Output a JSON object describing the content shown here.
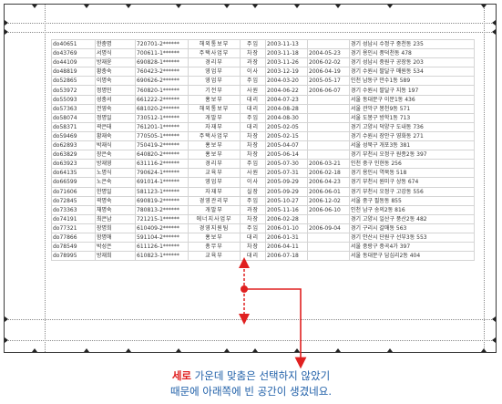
{
  "sheet": {
    "rows": [
      [
        "do40651",
        "한충명",
        "720701-2******",
        "해외통보부",
        "주임",
        "2003-11-13",
        "",
        "경기 성남시 수정구 중천동 235"
      ],
      [
        "do43769",
        "서명식",
        "700611-1******",
        "주택사업부",
        "차장",
        "2003-11-18",
        "2004-05-23",
        "경기 용인시 풍덕천동 478"
      ],
      [
        "do44109",
        "방재윤",
        "690828-1******",
        "경리부",
        "과장",
        "2003-11-26",
        "2006-02-02",
        "경기 성남시 중원구 공장동 203"
      ],
      [
        "do48819",
        "황충숙",
        "760423-2******",
        "영업부",
        "이사",
        "2003-12-19",
        "2006-04-19",
        "경기 수원시 팔달구 매원동 534"
      ],
      [
        "do52865",
        "이명숙",
        "690626-2******",
        "영업부",
        "주임",
        "2004-03-20",
        "2005-05-17",
        "인천 남동구 만수1동 589"
      ],
      [
        "do53972",
        "정명민",
        "760820-1******",
        "기전부",
        "사원",
        "2004-06-22",
        "2006-06-07",
        "경기 수원시 팔달구 지동 197"
      ],
      [
        "do55093",
        "성충서",
        "661222-2******",
        "홍보부",
        "대리",
        "2004-07-23",
        "",
        "서울 동대문구 이문1동 436"
      ],
      [
        "do57363",
        "전영숙",
        "681020-2******",
        "해외통보부",
        "대리",
        "2004-08-28",
        "",
        "서울 관악구 봉천9동 571"
      ],
      [
        "do58074",
        "정명일",
        "730512-1******",
        "개발부",
        "주임",
        "2004-08-30",
        "",
        "서울 도봉구 방학1동 713"
      ],
      [
        "do58371",
        "곽은태",
        "761201-1******",
        "자재부",
        "대리",
        "2005-02-05",
        "",
        "경기 고양시 덕양구 도내동 736"
      ],
      [
        "do59469",
        "황재숙",
        "770505-1******",
        "주택사업부",
        "차장",
        "2005-02-15",
        "",
        "경기 수원시 장안구 영화동 271"
      ],
      [
        "do62893",
        "박재식",
        "750419-2******",
        "홍보부",
        "차장",
        "2005-04-07",
        "",
        "서울 성북구 개포3동 381"
      ],
      [
        "do63829",
        "장은숙",
        "640820-2******",
        "홍보부",
        "차장",
        "2005-06-14",
        "",
        "경기 부천시 오정구 원종2동 397"
      ],
      [
        "do63923",
        "방재영",
        "631116-2******",
        "경리부",
        "주임",
        "2005-07-30",
        "2006-03-21",
        "인천 중구 인현동 256"
      ],
      [
        "do64135",
        "노명식",
        "790624-1******",
        "교육부",
        "사원",
        "2005-07-31",
        "2006-02-18",
        "경기 용인시 역북동 518"
      ],
      [
        "do66599",
        "노은숙",
        "691014-1******",
        "영업부",
        "이사",
        "2005-09-29",
        "2006-04-23",
        "경기 부천시 원미구 상동 674"
      ],
      [
        "do71606",
        "한명일",
        "581123-1******",
        "자재부",
        "실장",
        "2005-09-29",
        "2006-06-01",
        "경기 부천시 오정구 고강동 556"
      ],
      [
        "do72845",
        "곽명숙",
        "690819-2******",
        "경영관리부",
        "주임",
        "2005-10-27",
        "2006-12-02",
        "서울 중구 필동동 855"
      ],
      [
        "do73363",
        "채명숙",
        "780813-2******",
        "개발부",
        "과장",
        "2005-11-16",
        "2006-06-10",
        "인천 남구 송의2동 816"
      ],
      [
        "do74191",
        "최은남",
        "721215-1******",
        "에너지사업부",
        "차장",
        "2006-02-28",
        "",
        "경기 고양시 일산구 풍산2동 482"
      ],
      [
        "do77321",
        "장명희",
        "610409-2******",
        "경영지원팀",
        "주임",
        "2006-01-10",
        "2006-09-04",
        "경기 구리시 갈매동 563"
      ],
      [
        "do77866",
        "함명애",
        "591104-2******",
        "홍보부",
        "대리",
        "2006-01-31",
        "",
        "경기 안산시 단원구 선부3동 553"
      ],
      [
        "do78549",
        "박성은",
        "611126-1******",
        "총무부",
        "차장",
        "2006-04-11",
        "",
        "서울 중랑구 중곡4가 397"
      ],
      [
        "do78995",
        "방재희",
        "610823-1******",
        "교육부",
        "대리",
        "2006-07-18",
        "",
        "서울 동대문구 답십리2동 404"
      ]
    ]
  },
  "annotation": {
    "highlight": "세로",
    "line1_rest": " 가운데 맞춤은 선택하지 않았기",
    "line2": "때문에 아래쪽에 빈 공간이 생겼네요."
  },
  "colors": {
    "pointer": "#e02020",
    "note_text": "#1f5fa8"
  }
}
